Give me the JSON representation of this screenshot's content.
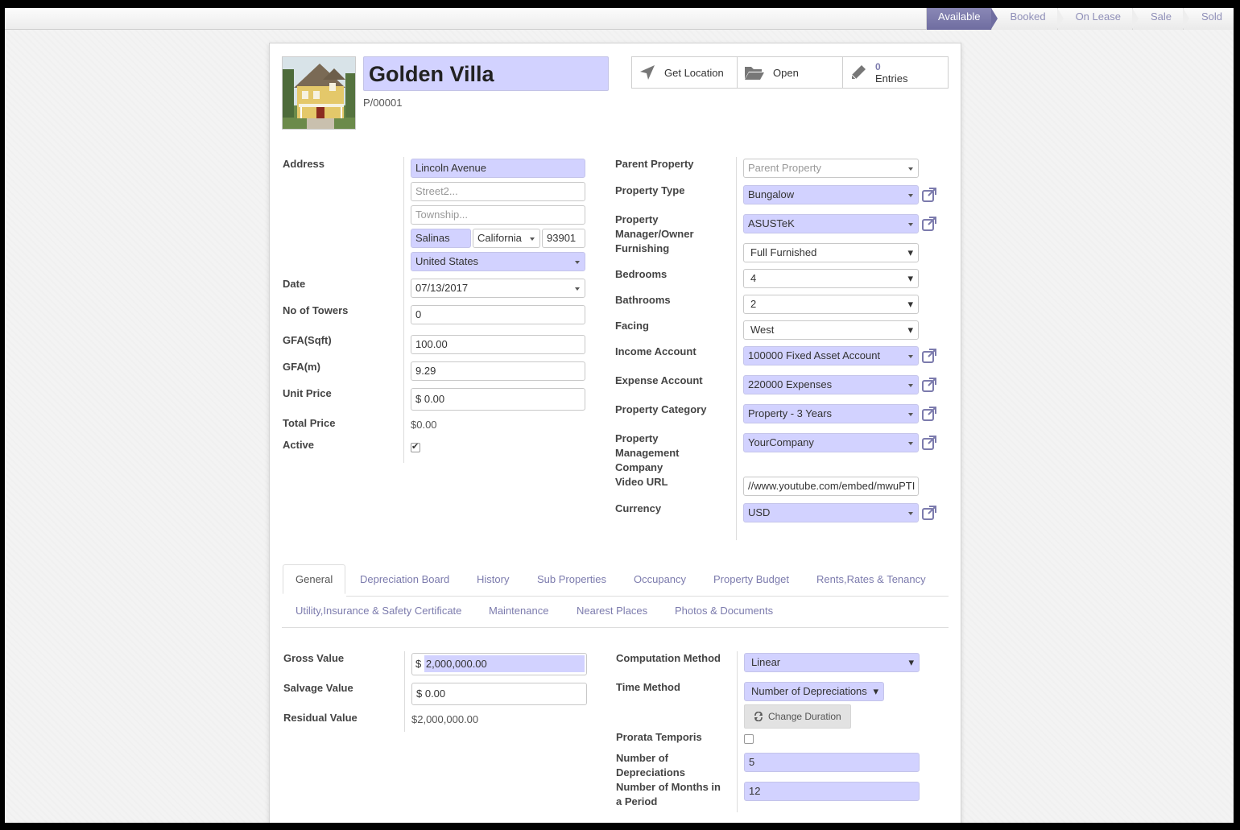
{
  "stages": [
    "Available",
    "Booked",
    "On Lease",
    "Sale",
    "Sold"
  ],
  "active_stage": "Available",
  "header": {
    "name": "Golden Villa",
    "ref": "P/00001",
    "smart_buttons": {
      "location": "Get Location",
      "open": "Open",
      "entries_count": "0",
      "entries_label": "Entries"
    }
  },
  "left": {
    "address_label": "Address",
    "street": "Lincoln Avenue",
    "street2_placeholder": "Street2...",
    "township_placeholder": "Township...",
    "city": "Salinas",
    "state": "California",
    "zip": "93901",
    "country": "United States",
    "date_label": "Date",
    "date": "07/13/2017",
    "towers_label": "No of Towers",
    "towers": "0",
    "gfa_sqft_label": "GFA(Sqft)",
    "gfa_sqft": "100.00",
    "gfa_m_label": "GFA(m)",
    "gfa_m": "9.29",
    "unit_price_label": "Unit Price",
    "unit_price": "$ 0.00",
    "total_price_label": "Total Price",
    "total_price": "$0.00",
    "active_label": "Active",
    "active": true
  },
  "right": {
    "parent_label": "Parent Property",
    "parent_placeholder": "Parent Property",
    "type_label": "Property Type",
    "type": "Bungalow",
    "manager_label": "Property Manager/Owner",
    "manager": "ASUSTeK",
    "furnishing_label": "Furnishing",
    "furnishing": "Full Furnished",
    "bedrooms_label": "Bedrooms",
    "bedrooms": "4",
    "bathrooms_label": "Bathrooms",
    "bathrooms": "2",
    "facing_label": "Facing",
    "facing": "West",
    "income_label": "Income Account",
    "income": "100000 Fixed Asset Account",
    "expense_label": "Expense Account",
    "expense": "220000 Expenses",
    "category_label": "Property Category",
    "category": "Property - 3 Years",
    "company_label": "Property Management Company",
    "company": "YourCompany",
    "video_label": "Video URL",
    "video": "//www.youtube.com/embed/mwuPTI",
    "currency_label": "Currency",
    "currency": "USD"
  },
  "tabs": [
    "General",
    "Depreciation Board",
    "History",
    "Sub Properties",
    "Occupancy",
    "Property Budget",
    "Rents,Rates & Tenancy",
    "Utility,Insurance & Safety Certificate",
    "Maintenance",
    "Nearest Places",
    "Photos & Documents"
  ],
  "general": {
    "gross_label": "Gross Value",
    "gross_currency": "$",
    "gross": "2,000,000.00",
    "salvage_label": "Salvage Value",
    "salvage": "$ 0.00",
    "residual_label": "Residual Value",
    "residual": "$2,000,000.00",
    "method_label": "Computation Method",
    "method": "Linear",
    "time_label": "Time Method",
    "time": "Number of Depreciations",
    "change_duration": "Change Duration",
    "prorata_label": "Prorata Temporis",
    "prorata": false,
    "num_dep_label": "Number of Depreciations",
    "num_dep": "5",
    "months_label": "Number of Months in a Period",
    "months": "12"
  },
  "colors": {
    "accent": "#7c7bad",
    "required_field": "#d2d2ff",
    "active_stage": "#7574a8"
  }
}
